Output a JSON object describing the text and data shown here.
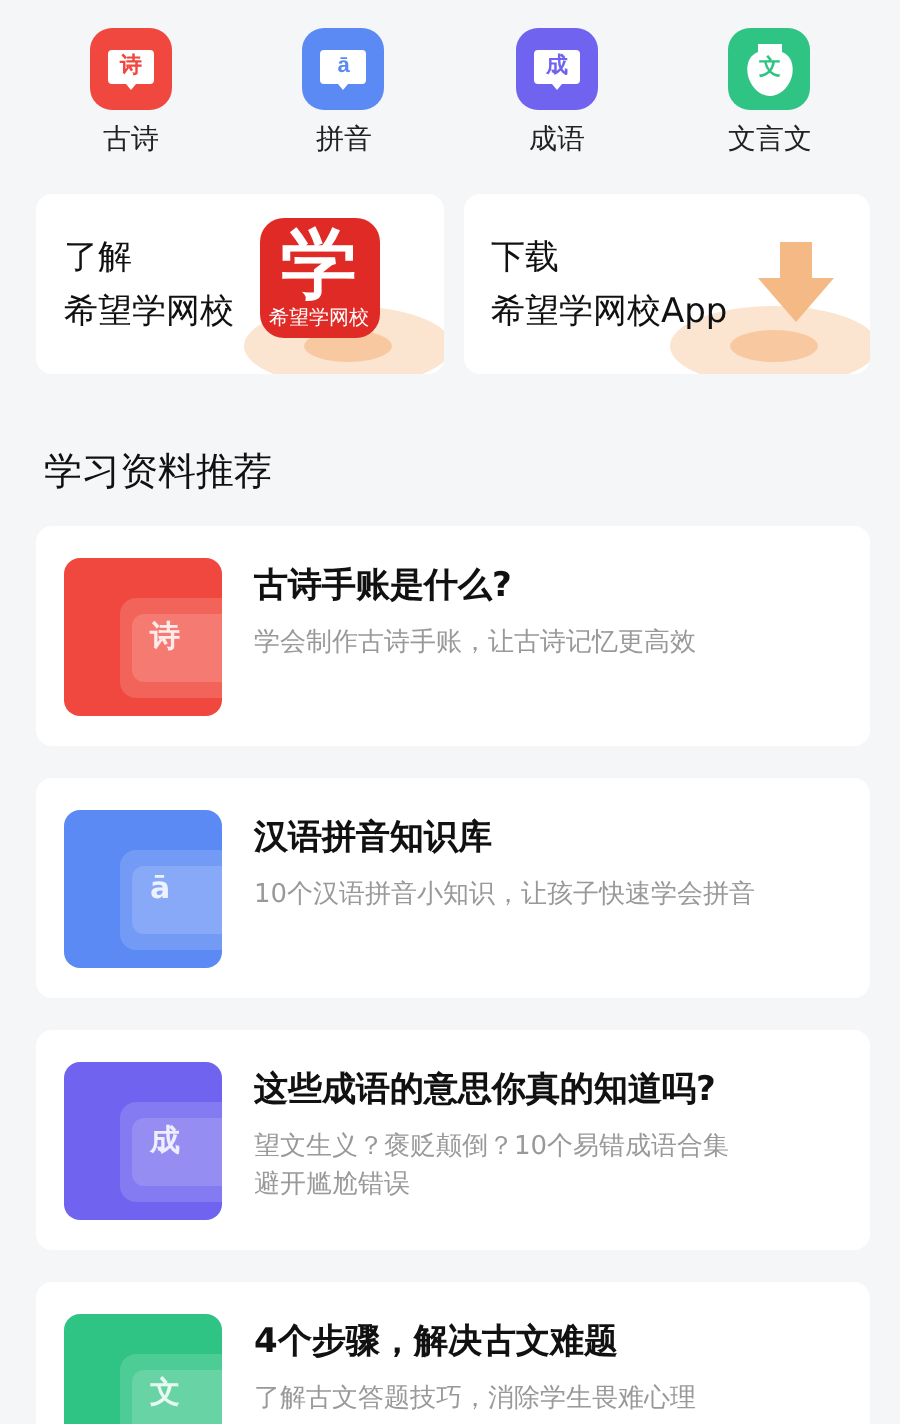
{
  "categories": [
    {
      "label": "古诗",
      "glyph": "诗",
      "color": "#f0483e",
      "kind": "bubble"
    },
    {
      "label": "拼音",
      "glyph": "ā",
      "color": "#5b8af5",
      "kind": "bubble"
    },
    {
      "label": "成语",
      "glyph": "成",
      "color": "#6f63ef",
      "kind": "bubble"
    },
    {
      "label": "文言文",
      "glyph": "文",
      "color": "#2fc384",
      "kind": "jar"
    }
  ],
  "promos": [
    {
      "kind": "logo",
      "lines": [
        "了解",
        "希望学网校"
      ],
      "logo_glyph": "学",
      "logo_caption": "希望学网校"
    },
    {
      "kind": "download",
      "lines": [
        "下载",
        "希望学网校App"
      ]
    }
  ],
  "section_title": "学习资料推荐",
  "articles": [
    {
      "title": "古诗手账是什么?",
      "subtitle": [
        "学会制作古诗手账，让古诗记忆更高效"
      ],
      "glyph": "诗",
      "color": "#f0483e"
    },
    {
      "title": "汉语拼音知识库",
      "subtitle": [
        "10个汉语拼音小知识，让孩子快速学会拼音"
      ],
      "glyph": "ā",
      "color": "#5b8af5"
    },
    {
      "title": "这些成语的意思你真的知道吗?",
      "subtitle": [
        "望文生义？褒贬颠倒？10个易错成语合集",
        "避开尴尬错误"
      ],
      "glyph": "成",
      "color": "#6f63ef"
    },
    {
      "title": "4个步骤，解决古文难题",
      "subtitle": [
        "了解古文答题技巧，消除学生畏难心理"
      ],
      "glyph": "文",
      "color": "#2fc384"
    }
  ]
}
